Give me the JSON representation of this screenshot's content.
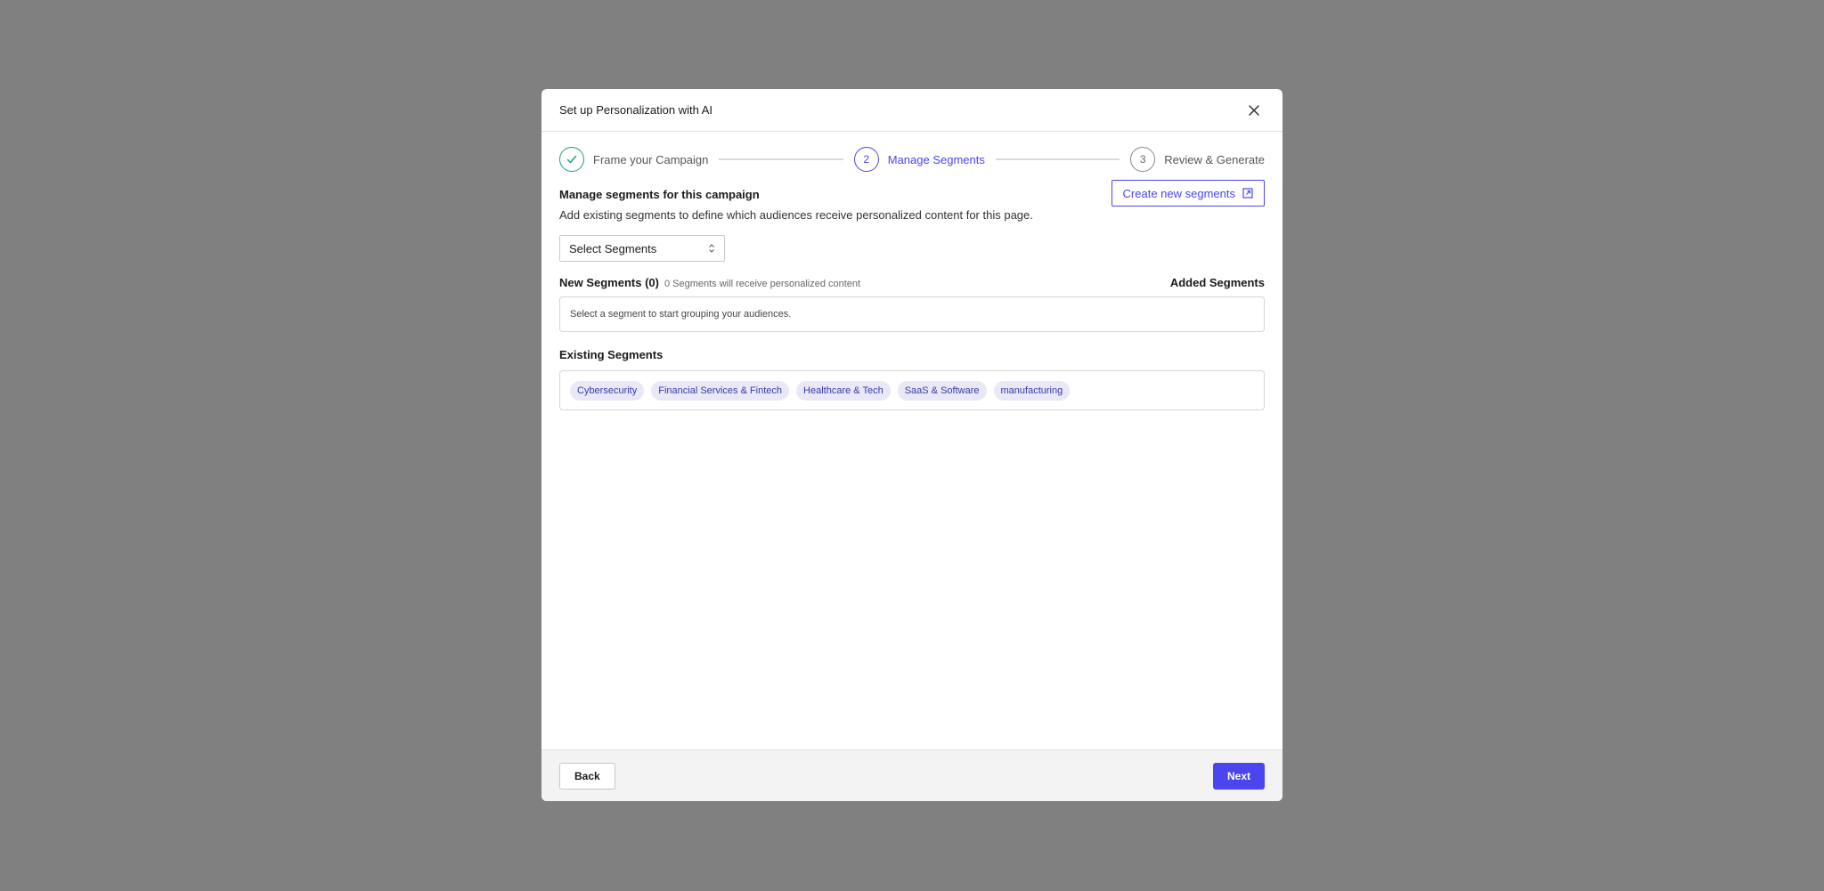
{
  "modal": {
    "title": "Set up Personalization with AI"
  },
  "stepper": {
    "steps": [
      {
        "label": "Frame your Campaign",
        "state": "done",
        "number": "1"
      },
      {
        "label": "Manage Segments",
        "state": "active",
        "number": "2"
      },
      {
        "label": "Review & Generate",
        "state": "pending",
        "number": "3"
      }
    ]
  },
  "manage": {
    "title": "Manage segments for this campaign",
    "description": "Add existing segments to define which audiences receive personalized content for this page.",
    "create_button": "Create new segments",
    "select_value": "Select Segments"
  },
  "new_segments": {
    "title": "New Segments (0)",
    "note": "0 Segments will receive personalized content",
    "added_label": "Added Segments",
    "empty_text": "Select a segment to start grouping your audiences."
  },
  "existing_segments": {
    "title": "Existing Segments",
    "chips": [
      "Cybersecurity",
      "Financial Services & Fintech",
      "Healthcare & Tech",
      "SaaS & Software",
      "manufacturing"
    ]
  },
  "footer": {
    "back": "Back",
    "next": "Next"
  },
  "colors": {
    "accent": "#4b45ef",
    "success": "#1f9e7c",
    "overlay": "#808080"
  }
}
